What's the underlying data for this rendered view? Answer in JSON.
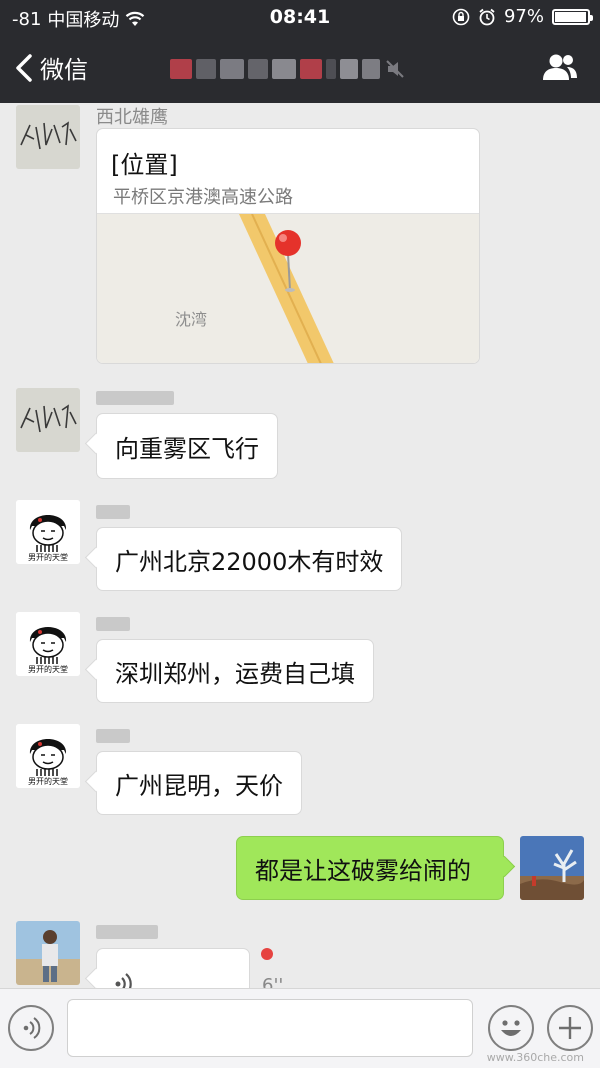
{
  "status_bar": {
    "signal": "-81",
    "carrier": "中国移动",
    "time": "08:41",
    "battery": "97%",
    "battery_level": 0.97
  },
  "nav": {
    "back_label": "微信"
  },
  "messages": [
    {
      "sender": "西北雄鹰",
      "location_title": "[位置]",
      "location_address": "平桥区京港澳高速公路",
      "map_label": "沈湾"
    },
    {
      "text": "向重雾区飞行"
    },
    {
      "text": "广州北京22000木有时效"
    },
    {
      "text": "深圳郑州，运费自己填"
    },
    {
      "text": "广州昆明，天价"
    },
    {
      "text": "都是让这破雾给闹的"
    },
    {
      "voice_duration": "6''"
    }
  ],
  "avatars": {
    "meme_caption": "男开的天堂"
  },
  "input": {
    "value": "",
    "placeholder": ""
  },
  "watermark": "www.360che.com",
  "colors": {
    "header_bg": "#2a2b2f",
    "chat_bg": "#ebebeb",
    "sent_bubble": "#a0e75a",
    "unread_dot": "#e64340"
  },
  "icons": [
    "back-chevron-icon",
    "wifi-icon",
    "lock-rotation-icon",
    "alarm-icon",
    "battery-icon",
    "contacts-icon",
    "voice-icon",
    "emoji-icon",
    "plus-icon"
  ]
}
